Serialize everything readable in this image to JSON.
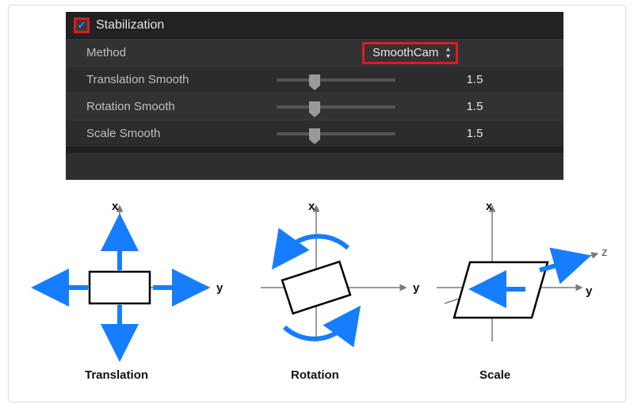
{
  "panel": {
    "title": "Stabilization",
    "enabled": true,
    "method": {
      "label": "Method",
      "value": "SmoothCam"
    },
    "params": [
      {
        "label": "Translation Smooth",
        "value": "1.5"
      },
      {
        "label": "Rotation Smooth",
        "value": "1.5"
      },
      {
        "label": "Scale Smooth",
        "value": "1.5"
      }
    ]
  },
  "diagrams": {
    "labels": [
      "Translation",
      "Rotation",
      "Scale"
    ],
    "axes": {
      "x": "x",
      "y": "y",
      "z": "z"
    }
  }
}
